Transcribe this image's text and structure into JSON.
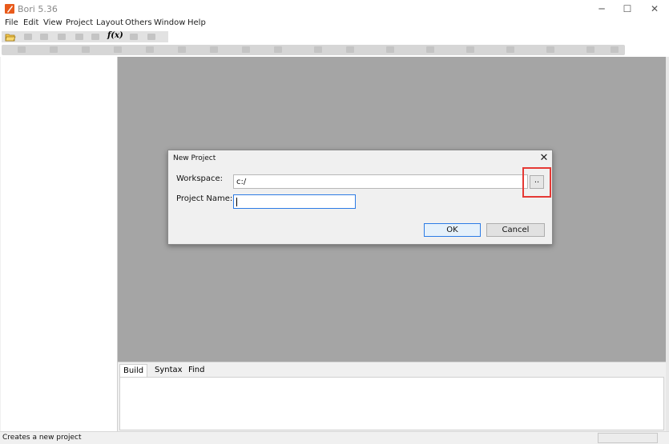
{
  "window": {
    "title": "Bori 5.36",
    "minimize_glyph": "─",
    "maximize_glyph": "☐",
    "close_glyph": "✕"
  },
  "menu": {
    "items": [
      "File",
      "Edit",
      "View",
      "Project",
      "Layout",
      "Others",
      "Window",
      "Help"
    ]
  },
  "toolbar": {
    "open_icon": "folder-open-icon",
    "function_label": "f(x)"
  },
  "dialog": {
    "title": "New Project",
    "close_glyph": "✕",
    "workspace_label": "Workspace:",
    "workspace_value": "c:/",
    "browse_label": "..",
    "project_name_label": "Project Name:",
    "project_name_value": "",
    "ok_label": "OK",
    "cancel_label": "Cancel",
    "highlight_color": "#e53935"
  },
  "bottom_tabs": [
    "Build",
    "Syntax",
    "Find"
  ],
  "status": {
    "message": "Creates a new project"
  }
}
